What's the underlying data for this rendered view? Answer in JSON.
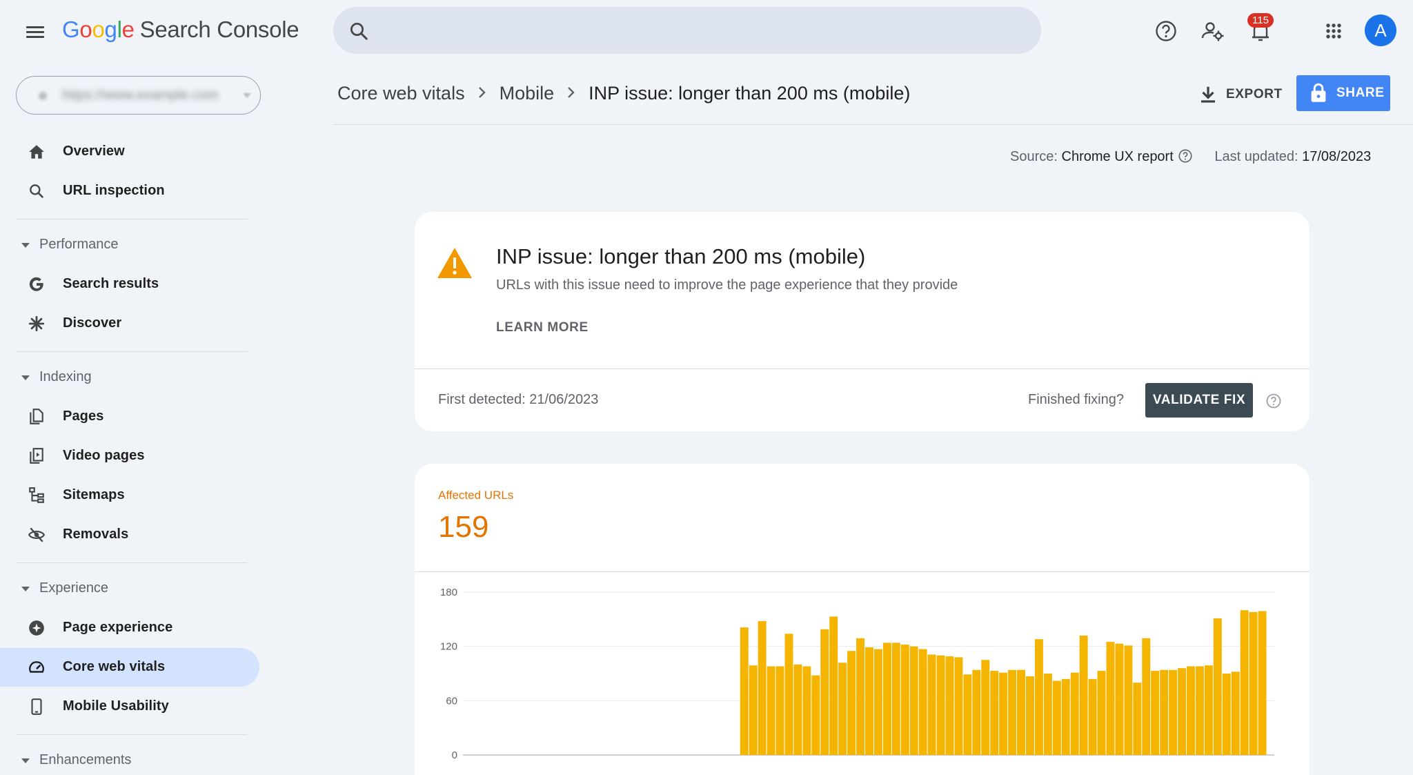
{
  "app": {
    "logo_parts": [
      "G",
      "o",
      "o",
      "g",
      "l",
      "e"
    ],
    "title": "Search Console"
  },
  "header": {
    "search_placeholder": "",
    "notification_count": "115",
    "avatar_letter": "A",
    "icons": [
      "menu-icon",
      "search-icon",
      "help-icon",
      "manage-users-icon",
      "notifications-icon",
      "apps-grid-icon"
    ]
  },
  "property": {
    "name": "https://www.example.com"
  },
  "sidebar": {
    "items": [
      {
        "id": "overview",
        "label": "Overview",
        "icon": "home-icon"
      },
      {
        "id": "url-inspection",
        "label": "URL inspection",
        "icon": "search-icon"
      },
      {
        "id": "search-results",
        "label": "Search results",
        "icon": "google-g-icon"
      },
      {
        "id": "discover",
        "label": "Discover",
        "icon": "asterisk-icon"
      },
      {
        "id": "pages",
        "label": "Pages",
        "icon": "pages-icon"
      },
      {
        "id": "video-pages",
        "label": "Video pages",
        "icon": "video-pages-icon"
      },
      {
        "id": "sitemaps",
        "label": "Sitemaps",
        "icon": "sitemap-icon"
      },
      {
        "id": "removals",
        "label": "Removals",
        "icon": "eye-off-icon"
      },
      {
        "id": "page-experience",
        "label": "Page experience",
        "icon": "plus-circle-icon"
      },
      {
        "id": "core-web-vitals",
        "label": "Core web vitals",
        "icon": "gauge-icon",
        "active": true
      },
      {
        "id": "mobile-usability",
        "label": "Mobile Usability",
        "icon": "phone-icon"
      }
    ],
    "sections": [
      "Performance",
      "Indexing",
      "Experience",
      "Enhancements"
    ]
  },
  "breadcrumb": [
    "Core web vitals",
    "Mobile",
    "INP issue: longer than 200 ms (mobile)"
  ],
  "actions": {
    "export_label": "EXPORT",
    "share_label": "SHARE"
  },
  "meta": {
    "source_label": "Source:",
    "source_value": "Chrome UX report",
    "updated_label": "Last updated:",
    "updated_value": "17/08/2023"
  },
  "issue": {
    "title": "INP issue: longer than 200 ms (mobile)",
    "subtitle": "URLs with this issue need to improve the page experience that they provide",
    "learn_more": "LEARN MORE",
    "first_detected": "First detected: 21/06/2023",
    "finished_prompt": "Finished fixing?",
    "validate_label": "VALIDATE FIX"
  },
  "affected": {
    "label": "Affected URLs",
    "value": "159"
  },
  "colors": {
    "accent": "#4285f4",
    "bars": "#f4b400",
    "warning": "#f29900",
    "affected": "#e37400"
  },
  "chart_data": {
    "type": "bar",
    "ylim": [
      0,
      180
    ],
    "yticks": [
      0,
      60,
      120,
      180
    ],
    "grid": true,
    "values": [
      null,
      null,
      null,
      null,
      null,
      null,
      null,
      null,
      null,
      null,
      null,
      null,
      null,
      null,
      null,
      null,
      null,
      null,
      null,
      null,
      null,
      null,
      null,
      null,
      null,
      null,
      null,
      null,
      null,
      null,
      null,
      141,
      99,
      148,
      98,
      98,
      134,
      100,
      98,
      88,
      139,
      153,
      102,
      115,
      129,
      119,
      117,
      124,
      124,
      122,
      120,
      117,
      111,
      110,
      109,
      108,
      89,
      94,
      105,
      93,
      91,
      94,
      94,
      87,
      128,
      90,
      82,
      84,
      91,
      132,
      84,
      93,
      125,
      123,
      121,
      80,
      129,
      93,
      94,
      94,
      96,
      98,
      98,
      99,
      151,
      90,
      92,
      160,
      158,
      159
    ]
  }
}
